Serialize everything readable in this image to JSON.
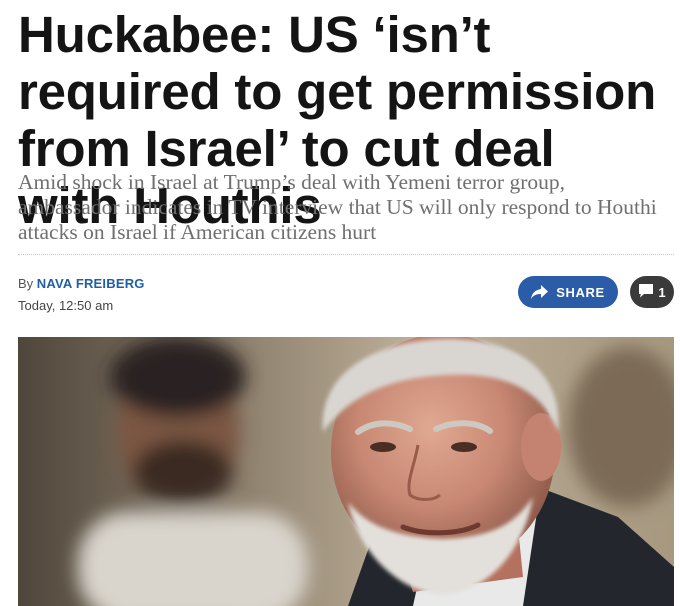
{
  "article": {
    "headline": "Huckabee: US ‘isn’t required to get permission from Israel’ to cut deal with Houthis",
    "subheadline": "Amid shock in Israel at Trump’s deal with Yemeni terror group, ambassador indicates in TV interview that US will only respond to Houthi attacks on Israel if American citizens hurt",
    "byline_prefix": "By",
    "author": "NAVA FREIBERG",
    "timestamp": "Today, 12:50 am"
  },
  "actions": {
    "share_label": "SHARE",
    "comment_count": "1"
  },
  "colors": {
    "share_button": "#2a5ca8",
    "comment_button": "#3a3a3a",
    "author_link": "#1f5ea8"
  },
  "icons": {
    "share": "share-arrow-icon",
    "comment": "comment-bubble-icon"
  }
}
